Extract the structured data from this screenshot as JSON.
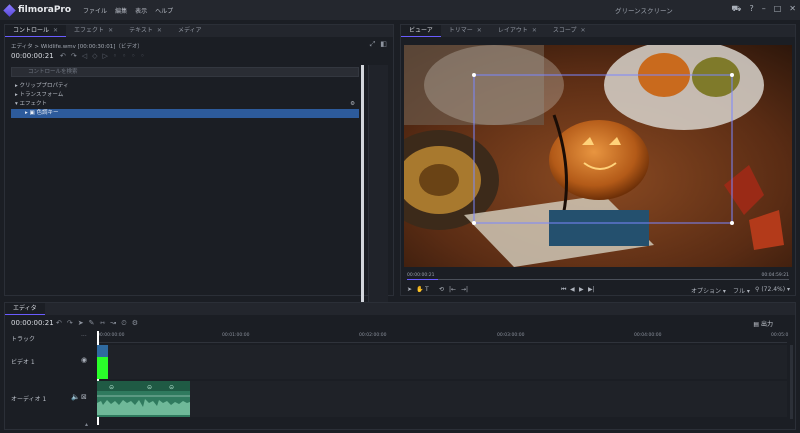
{
  "app": {
    "name": "filmoraPro",
    "window_title": "グリーンスクリーン"
  },
  "menu": [
    "ファイル",
    "編集",
    "表示",
    "ヘルプ"
  ],
  "left_tabs": [
    {
      "label": "コントロール",
      "active": true
    },
    {
      "label": "エフェクト",
      "active": false
    },
    {
      "label": "テキスト",
      "active": false
    },
    {
      "label": "メディア",
      "active": false
    }
  ],
  "controls": {
    "breadcrumb": "エディタ > Wildlife.wmv [00:00:30:01]（ビデオ）",
    "timecode": "00:00:00:21",
    "search_placeholder": "コントロールを検索",
    "tree": [
      {
        "label": "クリッププロパティ",
        "expanded": false,
        "selected": false
      },
      {
        "label": "トランスフォーム",
        "expanded": false,
        "selected": false
      },
      {
        "label": "エフェクト",
        "expanded": true,
        "selected": false
      },
      {
        "label": "色調キー",
        "expanded": false,
        "selected": true
      }
    ]
  },
  "right_tabs": [
    {
      "label": "ビューア",
      "active": true
    },
    {
      "label": "トリマー",
      "active": false
    },
    {
      "label": "レイアウト",
      "active": false
    },
    {
      "label": "スコープ",
      "active": false
    }
  ],
  "viewer": {
    "current_time": "00:00:00:21",
    "duration": "00:04:59:21",
    "playhead_fraction": 0.08,
    "option_label": "オプション",
    "quality_label": "フル",
    "zoom_label": "(72.4%)"
  },
  "editor": {
    "tab": "エディタ",
    "timecode": "00:00:00:21",
    "export_label": "出力",
    "track_label": "トラック",
    "video_track": "ビデオ 1",
    "audio_track": "オーディオ 1",
    "ruler_ticks": [
      "00:00:00:00",
      "00:01:00:00",
      "00:02:00:00",
      "00:03:00:00",
      "00:04:00:00",
      "00:05:0"
    ]
  },
  "colors": {
    "accent": "#6a5cff",
    "selection": "#2d5b9c",
    "video_clip": "#2aff2a",
    "audio_clip": "#2f7a5e"
  }
}
